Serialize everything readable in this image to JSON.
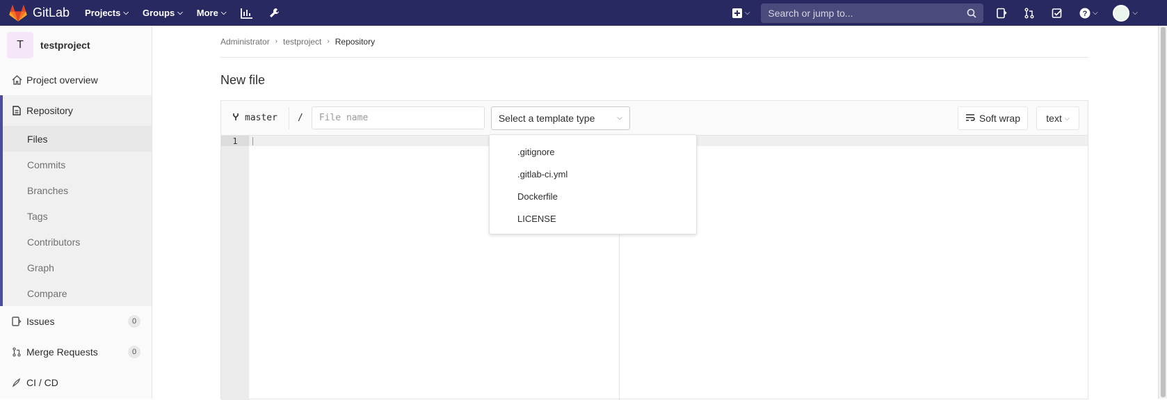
{
  "topbar": {
    "brand": "GitLab",
    "nav": [
      {
        "label": "Projects"
      },
      {
        "label": "Groups"
      },
      {
        "label": "More"
      }
    ],
    "search_placeholder": "Search or jump to..."
  },
  "sidebar": {
    "project_initial": "T",
    "project_name": "testproject",
    "overview": "Project overview",
    "repository": "Repository",
    "repo_items": [
      "Files",
      "Commits",
      "Branches",
      "Tags",
      "Contributors",
      "Graph",
      "Compare"
    ],
    "issues": {
      "label": "Issues",
      "count": "0"
    },
    "merge_requests": {
      "label": "Merge Requests",
      "count": "0"
    },
    "cicd": "CI / CD"
  },
  "breadcrumb": {
    "items": [
      "Administrator",
      "testproject",
      "Repository"
    ]
  },
  "page_title": "New file",
  "editor": {
    "branch": "master",
    "slash": "/",
    "filename_placeholder": "File name",
    "template_select": "Select a template type",
    "soft_wrap": "Soft wrap",
    "mode": "text",
    "line_numbers": [
      "1"
    ]
  },
  "template_dropdown": {
    "options": [
      ".gitignore",
      ".gitlab-ci.yml",
      "Dockerfile",
      "LICENSE"
    ]
  },
  "colors": {
    "topbar": "#292961",
    "accent": "#4b4ba3",
    "logo_orange": "#fc6d26"
  }
}
